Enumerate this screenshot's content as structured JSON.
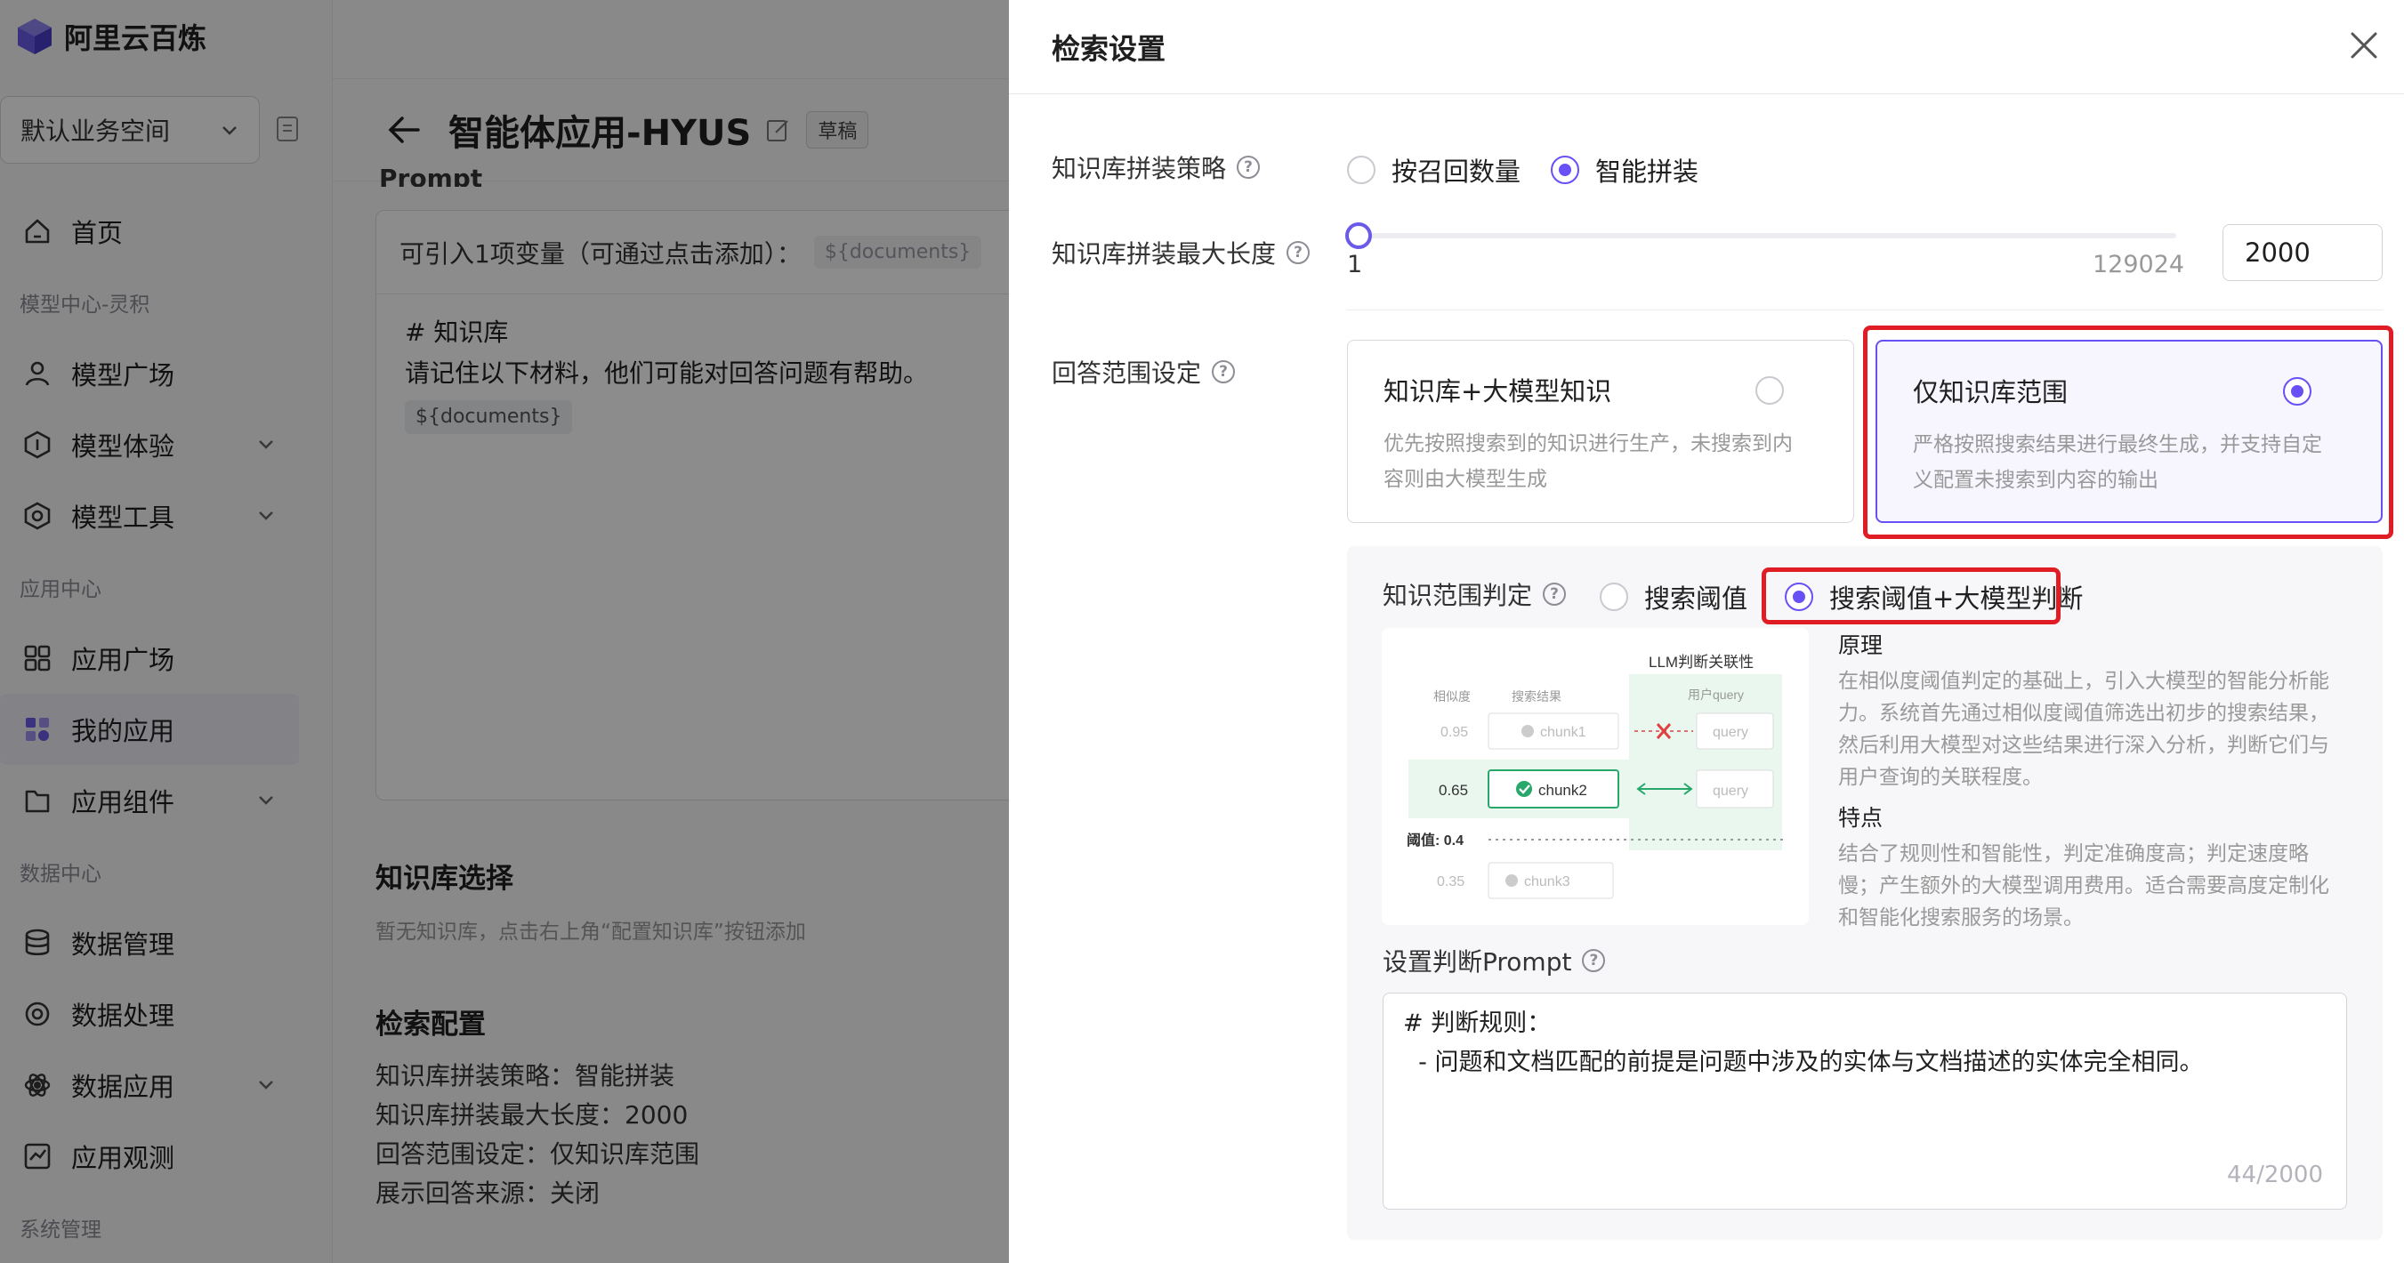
{
  "brand": {
    "name": "阿里云百炼",
    "accent": "#6750f5",
    "highlight": "#e01d24"
  },
  "sidebar": {
    "workspace": "默认业务空间",
    "items": [
      {
        "type": "item",
        "label": "首页",
        "icon": "home-icon"
      },
      {
        "type": "group",
        "label": "模型中心-灵积"
      },
      {
        "type": "item",
        "label": "模型广场",
        "icon": "model-square-icon"
      },
      {
        "type": "item",
        "label": "模型体验",
        "icon": "model-try-icon",
        "expandable": true
      },
      {
        "type": "item",
        "label": "模型工具",
        "icon": "model-tools-icon",
        "expandable": true
      },
      {
        "type": "group",
        "label": "应用中心"
      },
      {
        "type": "item",
        "label": "应用广场",
        "icon": "app-square-icon"
      },
      {
        "type": "item",
        "label": "我的应用",
        "icon": "my-apps-icon",
        "active": true
      },
      {
        "type": "item",
        "label": "应用组件",
        "icon": "app-components-icon",
        "expandable": true
      },
      {
        "type": "group",
        "label": "数据中心"
      },
      {
        "type": "item",
        "label": "数据管理",
        "icon": "database-icon"
      },
      {
        "type": "item",
        "label": "数据处理",
        "icon": "data-process-icon"
      },
      {
        "type": "item",
        "label": "数据应用",
        "icon": "data-app-icon",
        "expandable": true
      },
      {
        "type": "item",
        "label": "应用观测",
        "icon": "monitor-icon"
      },
      {
        "type": "group",
        "label": "系统管理"
      }
    ]
  },
  "main": {
    "app_title": "智能体应用-HYUS",
    "badge": "草稿",
    "prompt_section": "Prompt",
    "prompt_hint": "可引入1项变量（可通过点击添加）：",
    "prompt_var": "${documents}",
    "prompt_lines": [
      "# 知识库",
      "请记住以下材料，他们可能对回答问题有帮助。"
    ],
    "prompt_chip": "${documents}",
    "kb_title": "知识库选择",
    "kb_desc": "暂无知识库，点击右上角“配置知识库”按钮添加",
    "retrieval_title": "检索配置",
    "retrieval_lines": [
      "知识库拼装策略：智能拼装",
      "知识库拼装最大长度：2000",
      "回答范围设定：仅知识库范围",
      "展示回答来源：关闭"
    ]
  },
  "drawer": {
    "title": "检索设置",
    "strategy": {
      "label": "知识库拼装策略",
      "options": [
        "按召回数量",
        "智能拼装"
      ],
      "selected": 1
    },
    "maxlen": {
      "label": "知识库拼装最大长度",
      "min": "1",
      "max": "129024",
      "value": "2000"
    },
    "scope": {
      "label": "回答范围设定",
      "cards": [
        {
          "title": "知识库+大模型知识",
          "desc": "优先按照搜索到的知识进行生产，未搜索到内容则由大模型生成",
          "selected": false
        },
        {
          "title": "仅知识库范围",
          "desc": "严格按照搜索结果进行最终生成，并支持自定义配置未搜索到内容的输出",
          "selected": true
        }
      ]
    },
    "judge": {
      "label": "知识范围判定",
      "options": [
        "搜索阈值",
        "搜索阈值+大模型判断"
      ],
      "selected": 1
    },
    "illustration": {
      "header": "LLM判断关联性",
      "col_similarity": "相似度",
      "col_results": "搜索结果",
      "col_query": "用户query",
      "rows": [
        {
          "score": "0.95",
          "chunk": "chunk1",
          "query": "query"
        },
        {
          "score": "0.65",
          "chunk": "chunk2",
          "query": "query"
        },
        {
          "score": "0.35",
          "chunk": "chunk3"
        }
      ],
      "threshold": "阈值: 0.4"
    },
    "principle": {
      "title1": "原理",
      "text1": "在相似度阈值判定的基础上，引入大模型的智能分析能力。系统首先通过相似度阈值筛选出初步的搜索结果，然后利用大模型对这些结果进行深入分析，判断它们与用户查询的关联程度。",
      "title2": "特点",
      "text2": "结合了规则性和智能性，判定准确度高；判定速度略慢；产生额外的大模型调用费用。适合需要高度定制化和智能化搜索服务的场景。"
    },
    "prompt_setting": {
      "label": "设置判断Prompt",
      "lines": [
        "# 判断规则：",
        "  - 问题和文档匹配的前提是问题中涉及的实体与文档描述的实体完全相同。"
      ],
      "counter": "44/2000"
    }
  }
}
